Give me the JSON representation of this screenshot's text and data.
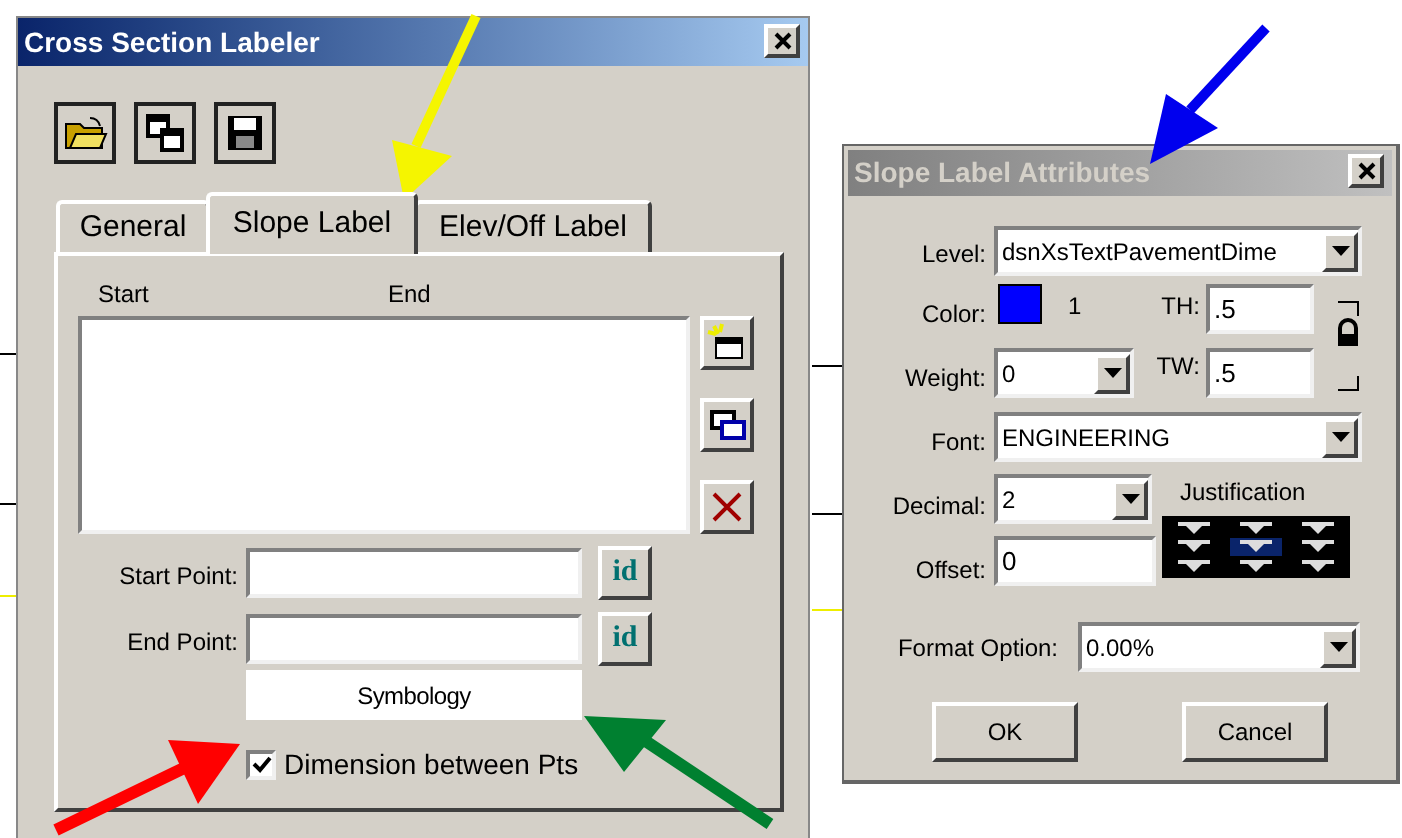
{
  "labeler": {
    "title": "Cross Section Labeler",
    "tabs": [
      {
        "label": "General",
        "selected": false
      },
      {
        "label": "Slope Label",
        "selected": true
      },
      {
        "label": "Elev/Off Label",
        "selected": false
      }
    ],
    "list_columns": [
      "Start",
      "End"
    ],
    "start_point": {
      "label": "Start Point:",
      "button": "id"
    },
    "end_point": {
      "label": "End Point:",
      "button": "id"
    },
    "symbology_button": "Symbology",
    "dimension_checkbox": {
      "label": "Dimension between Pts",
      "checked": true
    }
  },
  "attributes": {
    "title": "Slope Label Attributes",
    "level": {
      "label": "Level:",
      "value": "dsnXsTextPavementDime"
    },
    "color": {
      "label": "Color:",
      "color": "#0000ff",
      "number": "1"
    },
    "th": {
      "label": "TH:",
      "value": ".5"
    },
    "weight": {
      "label": "Weight:",
      "value": "0"
    },
    "tw": {
      "label": "TW:",
      "value": ".5"
    },
    "font": {
      "label": "Font:",
      "value": "ENGINEERING"
    },
    "decimal": {
      "label": "Decimal:",
      "value": "2"
    },
    "offset": {
      "label": "Offset:",
      "value": "0"
    },
    "justification": {
      "label": "Justification",
      "cells": [
        {
          "selected": false
        },
        {
          "selected": false
        },
        {
          "selected": false
        },
        {
          "selected": false
        },
        {
          "selected": true
        },
        {
          "selected": false
        },
        {
          "selected": false
        },
        {
          "selected": false
        },
        {
          "selected": false
        }
      ]
    },
    "format_option": {
      "label": "Format Option:",
      "value": "0.00%"
    },
    "buttons": [
      "OK",
      "Cancel"
    ]
  }
}
